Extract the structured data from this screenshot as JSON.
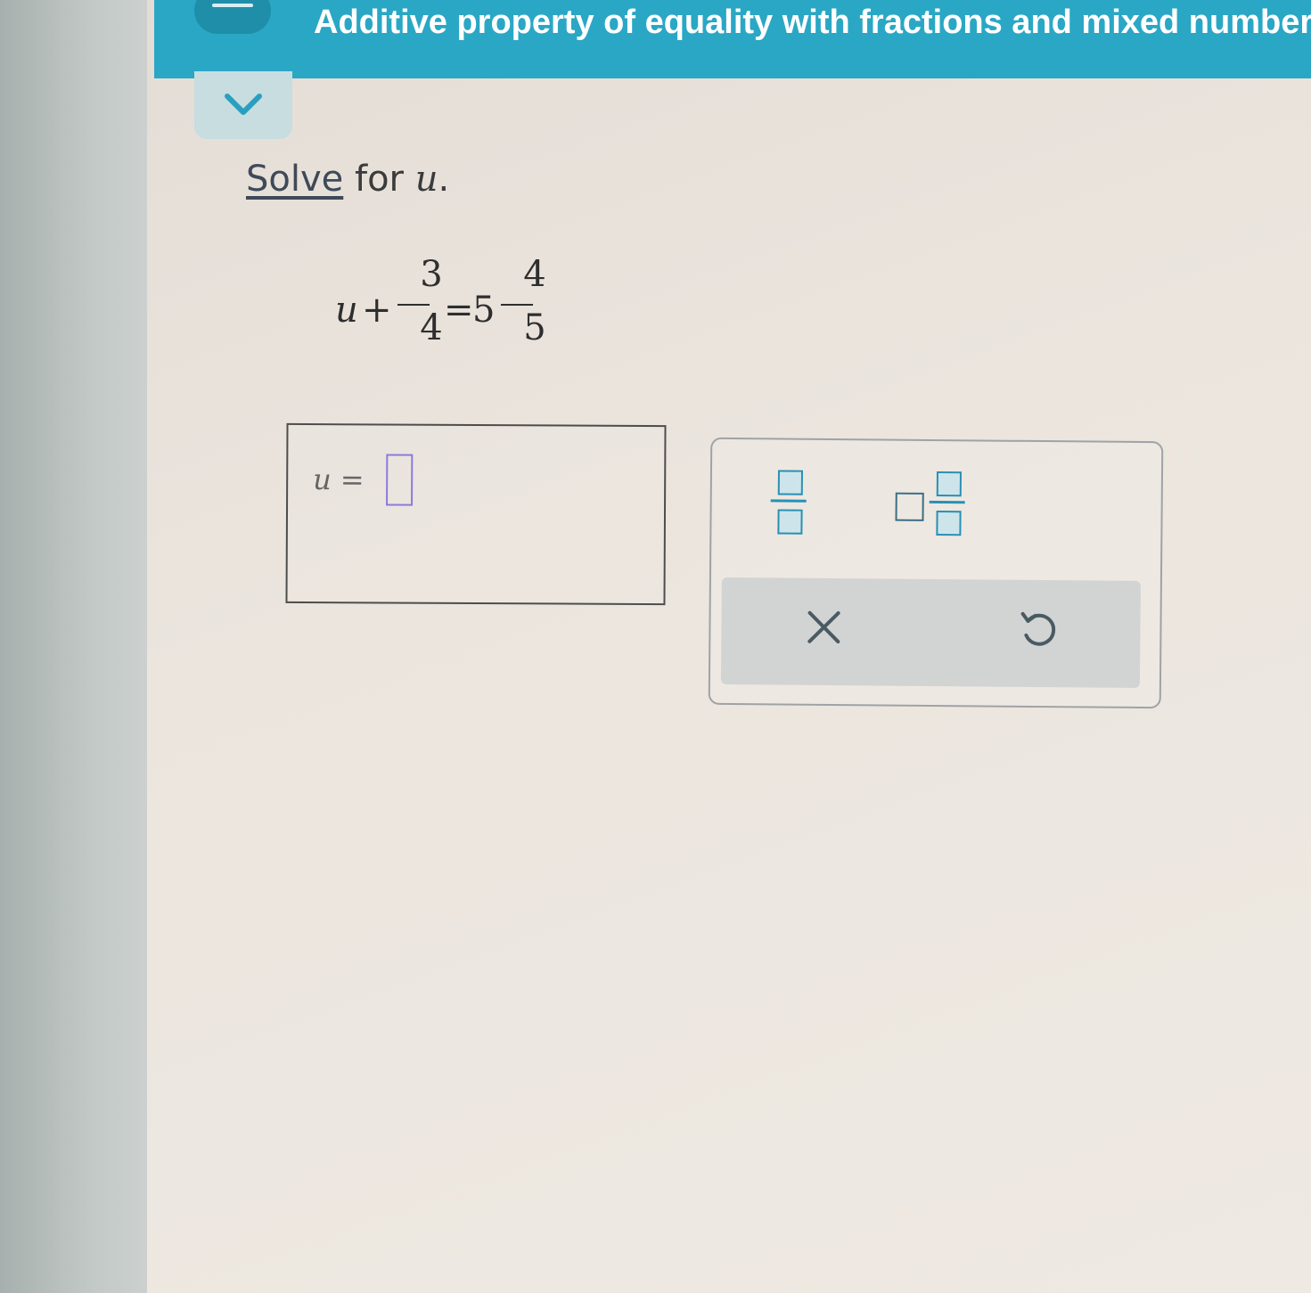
{
  "header": {
    "title": "Additive property of equality with fractions and mixed numbers"
  },
  "problem": {
    "instruction_verb": "Solve",
    "instruction_rest": "for",
    "variable": "u",
    "period": ".",
    "equation": {
      "lhs_var": "u",
      "plus": "+",
      "frac1_num": "3",
      "frac1_den": "4",
      "equals": "=",
      "whole": "5",
      "frac2_num": "4",
      "frac2_den": "5"
    }
  },
  "answer": {
    "label_var": "u",
    "label_eq": "=",
    "value": ""
  },
  "keypad": {
    "clear_symbol": "✕",
    "undo_symbol": "↺"
  },
  "colors": {
    "header": "#2aa7c5",
    "accent": "#2a90b3",
    "input_border": "#8b7bdc"
  }
}
